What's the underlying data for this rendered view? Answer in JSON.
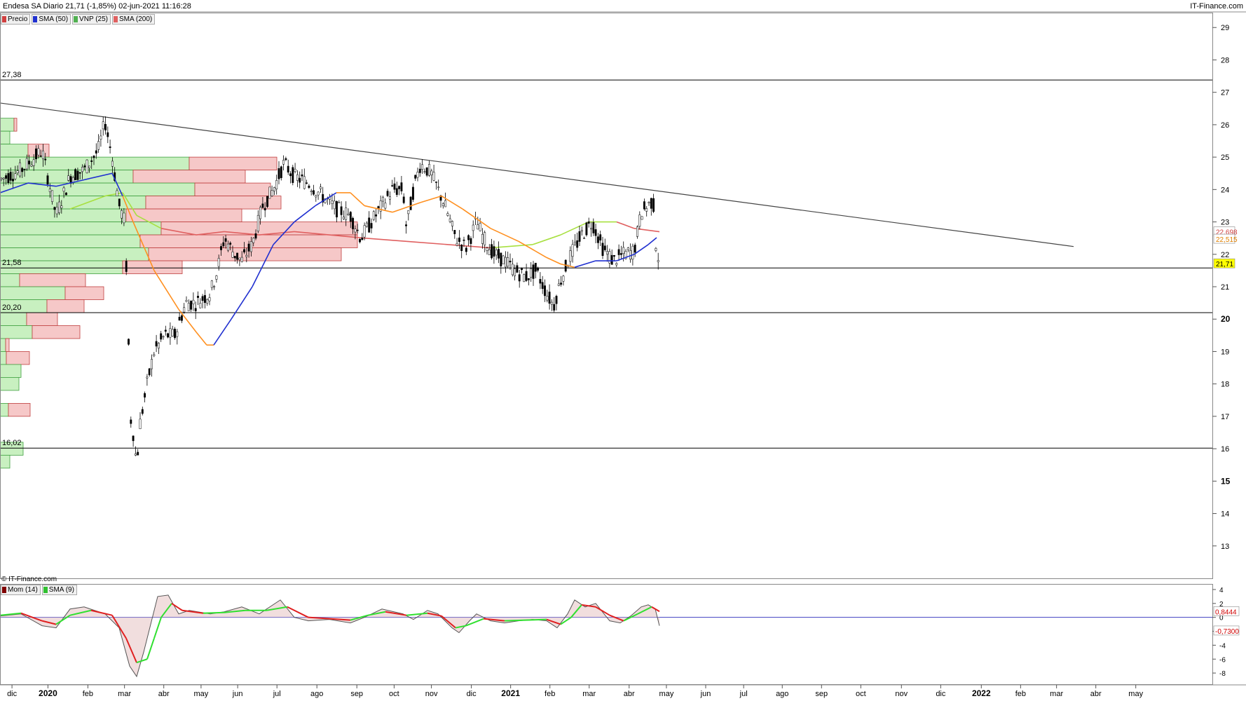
{
  "header": {
    "title": "Endesa SA Diario 21,71 (-1,85%) 02-jun-2021 11:16:28",
    "brand": "IT-Finance.com",
    "watermark": "© IT-Finance.com"
  },
  "legend": [
    {
      "label": "Precio",
      "color": "#d04040"
    },
    {
      "label": "SMA (50)",
      "color": "#2030d0"
    },
    {
      "label": "VNP (25)",
      "color": "#50b050"
    },
    {
      "label": "SMA (200)",
      "color": "#e06060"
    }
  ],
  "mom_legend": [
    {
      "label": "Mom (14)",
      "color": "#800000"
    },
    {
      "label": "SMA (9)",
      "color": "#30c030"
    }
  ],
  "chart_data": {
    "type": "candlestick",
    "title": "Endesa SA Diario",
    "y_range": [
      12,
      29.2
    ],
    "y_ticks": [
      "29",
      "28",
      "27",
      "26",
      "25",
      "24",
      "23",
      "22",
      "21",
      "20",
      "19",
      "18",
      "17",
      "16",
      "15",
      "14",
      "13"
    ],
    "x_labels": [
      "dic",
      "2020",
      "feb",
      "mar",
      "abr",
      "may",
      "jun",
      "jul",
      "ago",
      "sep",
      "oct",
      "nov",
      "dic",
      "2021",
      "feb",
      "mar",
      "abr",
      "may",
      "jun",
      "jul",
      "ago",
      "sep",
      "oct",
      "nov",
      "dic",
      "2022",
      "feb",
      "mar",
      "abr",
      "may"
    ],
    "price_path": [
      [
        0,
        24.3
      ],
      [
        30,
        24.6
      ],
      [
        60,
        25.2
      ],
      [
        80,
        23.2
      ],
      [
        100,
        24.4
      ],
      [
        120,
        24.6
      ],
      [
        140,
        25.2
      ],
      [
        150,
        26.1
      ],
      [
        160,
        25.0
      ],
      [
        170,
        23.5
      ],
      [
        178,
        23.0
      ],
      [
        182,
        20.5
      ],
      [
        186,
        17.0
      ],
      [
        190,
        16.5
      ],
      [
        195,
        15.5
      ],
      [
        200,
        16.8
      ],
      [
        210,
        18.0
      ],
      [
        220,
        19.0
      ],
      [
        235,
        19.5
      ],
      [
        250,
        19.5
      ],
      [
        265,
        20.5
      ],
      [
        280,
        20.5
      ],
      [
        300,
        20.8
      ],
      [
        310,
        21.5
      ],
      [
        320,
        22.5
      ],
      [
        335,
        22.0
      ],
      [
        345,
        21.8
      ],
      [
        360,
        22.3
      ],
      [
        375,
        23.5
      ],
      [
        390,
        24.0
      ],
      [
        405,
        24.8
      ],
      [
        420,
        24.4
      ],
      [
        440,
        24.2
      ],
      [
        460,
        23.8
      ],
      [
        480,
        23.4
      ],
      [
        500,
        23.2
      ],
      [
        515,
        22.5
      ],
      [
        530,
        23.0
      ],
      [
        545,
        23.5
      ],
      [
        560,
        24.0
      ],
      [
        575,
        24.0
      ],
      [
        580,
        22.8
      ],
      [
        590,
        24.0
      ],
      [
        600,
        24.8
      ],
      [
        615,
        24.5
      ],
      [
        625,
        24.0
      ],
      [
        635,
        23.5
      ],
      [
        650,
        22.5
      ],
      [
        665,
        22.2
      ],
      [
        680,
        23.0
      ],
      [
        690,
        22.5
      ],
      [
        705,
        22.0
      ],
      [
        720,
        21.8
      ],
      [
        735,
        21.5
      ],
      [
        750,
        21.3
      ],
      [
        765,
        21.5
      ],
      [
        780,
        20.8
      ],
      [
        790,
        20.4
      ],
      [
        800,
        21.2
      ],
      [
        815,
        22.0
      ],
      [
        830,
        22.6
      ],
      [
        845,
        23.0
      ],
      [
        860,
        22.2
      ],
      [
        875,
        21.8
      ],
      [
        890,
        22.0
      ],
      [
        905,
        22.1
      ],
      [
        915,
        23.3
      ],
      [
        925,
        23.5
      ],
      [
        932,
        23.7
      ],
      [
        936,
        22.3
      ],
      [
        941,
        21.71
      ]
    ],
    "sma50": [
      [
        0,
        23.9
      ],
      [
        40,
        24.2
      ],
      [
        80,
        24.1
      ],
      [
        120,
        24.3
      ],
      [
        160,
        24.5
      ],
      [
        175,
        23.8
      ],
      [
        190,
        23.0
      ],
      [
        220,
        21.5
      ],
      [
        255,
        20.3
      ],
      [
        280,
        19.6
      ],
      [
        295,
        19.2
      ],
      [
        305,
        19.2
      ],
      [
        330,
        20.0
      ],
      [
        360,
        21.0
      ],
      [
        390,
        22.3
      ],
      [
        420,
        23.0
      ],
      [
        450,
        23.5
      ],
      [
        480,
        23.9
      ],
      [
        500,
        23.9
      ],
      [
        520,
        23.5
      ],
      [
        560,
        23.3
      ],
      [
        600,
        23.6
      ],
      [
        630,
        23.8
      ],
      [
        660,
        23.4
      ],
      [
        700,
        22.8
      ],
      [
        740,
        22.4
      ],
      [
        780,
        21.9
      ],
      [
        800,
        21.7
      ],
      [
        820,
        21.6
      ],
      [
        850,
        21.8
      ],
      [
        880,
        21.8
      ],
      [
        905,
        22.0
      ],
      [
        925,
        22.3
      ],
      [
        937,
        22.515
      ]
    ],
    "sma200": [
      [
        100,
        23.4
      ],
      [
        150,
        23.8
      ],
      [
        175,
        23.9
      ],
      [
        195,
        23.2
      ],
      [
        230,
        22.8
      ],
      [
        280,
        22.6
      ],
      [
        320,
        22.7
      ],
      [
        370,
        22.6
      ],
      [
        420,
        22.7
      ],
      [
        470,
        22.6
      ],
      [
        520,
        22.5
      ],
      [
        580,
        22.4
      ],
      [
        640,
        22.3
      ],
      [
        700,
        22.2
      ],
      [
        760,
        22.3
      ],
      [
        800,
        22.6
      ],
      [
        840,
        23.0
      ],
      [
        880,
        23.0
      ],
      [
        905,
        22.8
      ],
      [
        941,
        22.698
      ]
    ],
    "sma200_label": "22,698",
    "sma50_label": "22,515",
    "last_price_label": "21,71",
    "trendline": {
      "start": [
        0,
        26.67
      ],
      "end": [
        1532,
        22.24
      ]
    },
    "h_levels": [
      {
        "value": 27.38,
        "label": "27,38"
      },
      {
        "value": 21.58,
        "label": "21,58"
      },
      {
        "value": 20.2,
        "label": "20,20"
      },
      {
        "value": 16.02,
        "label": "16,02"
      }
    ],
    "volume_profile": [
      {
        "price": 26.0,
        "buy": 20,
        "sell": 4
      },
      {
        "price": 25.6,
        "buy": 14,
        "sell": 0
      },
      {
        "price": 25.2,
        "buy": 40,
        "sell": 30
      },
      {
        "price": 24.8,
        "buy": 270,
        "sell": 125
      },
      {
        "price": 24.4,
        "buy": 190,
        "sell": 160
      },
      {
        "price": 24.0,
        "buy": 278,
        "sell": 108
      },
      {
        "price": 23.6,
        "buy": 208,
        "sell": 193
      },
      {
        "price": 23.2,
        "buy": 180,
        "sell": 165
      },
      {
        "price": 22.8,
        "buy": 230,
        "sell": 280
      },
      {
        "price": 22.4,
        "buy": 200,
        "sell": 310
      },
      {
        "price": 22.0,
        "buy": 212,
        "sell": 275
      },
      {
        "price": 21.6,
        "buy": 175,
        "sell": 85
      },
      {
        "price": 21.2,
        "buy": 28,
        "sell": 94
      },
      {
        "price": 20.8,
        "buy": 93,
        "sell": 55
      },
      {
        "price": 20.4,
        "buy": 67,
        "sell": 53
      },
      {
        "price": 20.0,
        "buy": 38,
        "sell": 44
      },
      {
        "price": 19.6,
        "buy": 46,
        "sell": 68
      },
      {
        "price": 19.2,
        "buy": 8,
        "sell": 5
      },
      {
        "price": 18.8,
        "buy": 9,
        "sell": 33
      },
      {
        "price": 18.4,
        "buy": 30,
        "sell": 0
      },
      {
        "price": 18.0,
        "buy": 27,
        "sell": 0
      },
      {
        "price": 17.2,
        "buy": 12,
        "sell": 31
      },
      {
        "price": 16.0,
        "buy": 33,
        "sell": 0
      },
      {
        "price": 15.6,
        "buy": 14,
        "sell": 0
      }
    ],
    "momentum": {
      "y_ticks": [
        "4",
        "2",
        "0",
        "-2",
        "-4",
        "-6",
        "-8"
      ],
      "mom_label": "0,8444",
      "sma_label": "-0,7300",
      "mom_path": [
        [
          0,
          0.2
        ],
        [
          30,
          0.5
        ],
        [
          60,
          -1.2
        ],
        [
          80,
          -1.5
        ],
        [
          100,
          1.2
        ],
        [
          120,
          1.5
        ],
        [
          150,
          0.5
        ],
        [
          170,
          -1.5
        ],
        [
          185,
          -7.0
        ],
        [
          195,
          -8.5
        ],
        [
          205,
          -5.0
        ],
        [
          215,
          -1.0
        ],
        [
          225,
          3.0
        ],
        [
          240,
          3.2
        ],
        [
          255,
          0.5
        ],
        [
          270,
          1.0
        ],
        [
          300,
          0.5
        ],
        [
          320,
          0.8
        ],
        [
          345,
          1.5
        ],
        [
          370,
          0.5
        ],
        [
          400,
          2.5
        ],
        [
          420,
          0.0
        ],
        [
          440,
          -0.5
        ],
        [
          470,
          -0.3
        ],
        [
          500,
          -0.8
        ],
        [
          520,
          0.0
        ],
        [
          545,
          1.2
        ],
        [
          575,
          0.5
        ],
        [
          590,
          -0.3
        ],
        [
          610,
          1.0
        ],
        [
          625,
          0.5
        ],
        [
          645,
          -1.5
        ],
        [
          655,
          -2.2
        ],
        [
          670,
          -0.5
        ],
        [
          680,
          0.5
        ],
        [
          700,
          -0.5
        ],
        [
          720,
          -0.8
        ],
        [
          740,
          -0.5
        ],
        [
          760,
          -0.3
        ],
        [
          780,
          -0.5
        ],
        [
          795,
          -1.5
        ],
        [
          810,
          0.5
        ],
        [
          820,
          2.5
        ],
        [
          835,
          1.5
        ],
        [
          850,
          2.0
        ],
        [
          870,
          -0.5
        ],
        [
          885,
          -0.8
        ],
        [
          900,
          0.2
        ],
        [
          915,
          1.5
        ],
        [
          925,
          1.8
        ],
        [
          935,
          1.2
        ],
        [
          941,
          -1.2
        ]
      ],
      "sma_path": [
        [
          0,
          0.3
        ],
        [
          30,
          0.6
        ],
        [
          60,
          -0.5
        ],
        [
          80,
          -1.0
        ],
        [
          100,
          0.3
        ],
        [
          130,
          1.0
        ],
        [
          160,
          0.3
        ],
        [
          180,
          -3.0
        ],
        [
          195,
          -6.5
        ],
        [
          210,
          -6.0
        ],
        [
          220,
          -3.0
        ],
        [
          230,
          0.0
        ],
        [
          245,
          2.0
        ],
        [
          260,
          1.0
        ],
        [
          290,
          0.6
        ],
        [
          320,
          0.7
        ],
        [
          350,
          1.0
        ],
        [
          380,
          1.0
        ],
        [
          410,
          1.5
        ],
        [
          440,
          0.0
        ],
        [
          470,
          -0.2
        ],
        [
          500,
          -0.4
        ],
        [
          525,
          0.3
        ],
        [
          550,
          0.8
        ],
        [
          580,
          0.3
        ],
        [
          610,
          0.6
        ],
        [
          630,
          0.2
        ],
        [
          650,
          -1.5
        ],
        [
          665,
          -1.2
        ],
        [
          690,
          -0.2
        ],
        [
          720,
          -0.5
        ],
        [
          750,
          -0.4
        ],
        [
          780,
          -0.3
        ],
        [
          800,
          -1.0
        ],
        [
          815,
          0.0
        ],
        [
          830,
          1.8
        ],
        [
          850,
          1.5
        ],
        [
          870,
          0.3
        ],
        [
          890,
          -0.5
        ],
        [
          910,
          0.5
        ],
        [
          930,
          1.5
        ],
        [
          941,
          0.8444
        ]
      ]
    }
  }
}
